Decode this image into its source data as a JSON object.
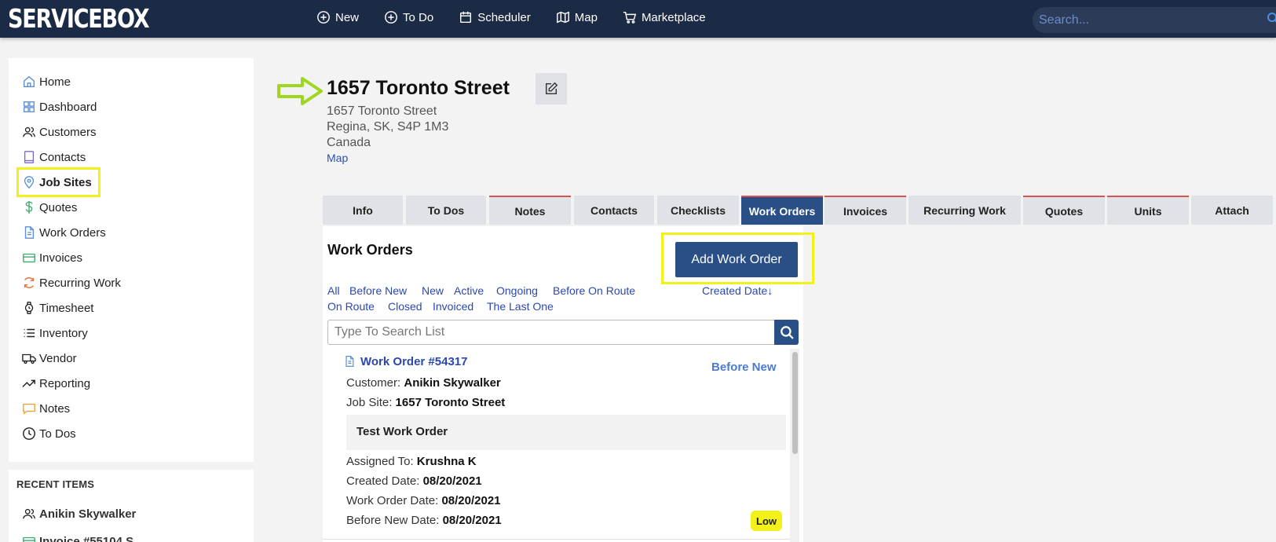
{
  "brand": {
    "logo_text": "SERVICEBOX"
  },
  "topnav": {
    "new": "New",
    "todo": "To Do",
    "scheduler": "Scheduler",
    "map": "Map",
    "marketplace": "Marketplace",
    "search_placeholder": "Search..."
  },
  "sidebar": {
    "items": [
      {
        "label": "Home",
        "icon": "home-icon"
      },
      {
        "label": "Dashboard",
        "icon": "dashboard-icon"
      },
      {
        "label": "Customers",
        "icon": "users-icon"
      },
      {
        "label": "Contacts",
        "icon": "book-icon"
      },
      {
        "label": "Job Sites",
        "icon": "location-pin-icon",
        "active": true
      },
      {
        "label": "Quotes",
        "icon": "dollar-icon"
      },
      {
        "label": "Work Orders",
        "icon": "document-icon"
      },
      {
        "label": "Invoices",
        "icon": "credit-card-icon"
      },
      {
        "label": "Recurring Work",
        "icon": "refresh-icon"
      },
      {
        "label": "Timesheet",
        "icon": "watch-icon"
      },
      {
        "label": "Inventory",
        "icon": "list-icon"
      },
      {
        "label": "Vendor",
        "icon": "truck-icon"
      },
      {
        "label": "Reporting",
        "icon": "trend-up-icon"
      },
      {
        "label": "Notes",
        "icon": "chat-icon"
      },
      {
        "label": "To Dos",
        "icon": "clock-icon"
      }
    ]
  },
  "recent": {
    "title": "RECENT ITEMS",
    "items": [
      "Anikin Skywalker",
      "Invoice #55104 S"
    ]
  },
  "jobsite": {
    "title": "1657 Toronto Street",
    "address_line1": "1657 Toronto Street",
    "address_line2": "Regina, SK, S4P 1M3",
    "address_line3": "Canada",
    "map_link": "Map"
  },
  "tabs": [
    "Info",
    "To Dos",
    "Notes",
    "Contacts",
    "Checklists",
    "Work Orders",
    "Invoices",
    "Recurring Work",
    "Quotes",
    "Units",
    "Attach"
  ],
  "panel": {
    "title": "Work Orders",
    "add_button": "Add Work Order",
    "filters_row1": [
      "All",
      "Before New",
      "New",
      "Active",
      "Ongoing",
      "Before On Route"
    ],
    "filters_row2": [
      "On Route",
      "Closed",
      "Invoiced",
      "The Last One"
    ],
    "sort_label": "Created Date",
    "sort_arrow": "↓",
    "search_placeholder": "Type To Search List"
  },
  "work_order": {
    "title": "Work Order #54317",
    "status": "Before New",
    "customer_label": "Customer:",
    "customer": "Anikin Skywalker",
    "jobsite_label": "Job Site:",
    "jobsite": "1657 Toronto Street",
    "description": "Test Work Order",
    "assigned_label": "Assigned To:",
    "assigned": "Krushna K",
    "created_label": "Created Date:",
    "created": "08/20/2021",
    "wo_date_label": "Work Order Date:",
    "wo_date": "08/20/2021",
    "before_new_label": "Before New Date:",
    "before_new": "08/20/2021",
    "priority": "Low"
  },
  "colors": {
    "navbar": "#1b2a45",
    "accent": "#2a4f86",
    "link": "#2a48b0",
    "highlight": "#f2f21a",
    "arrow": "#9fd61f"
  }
}
